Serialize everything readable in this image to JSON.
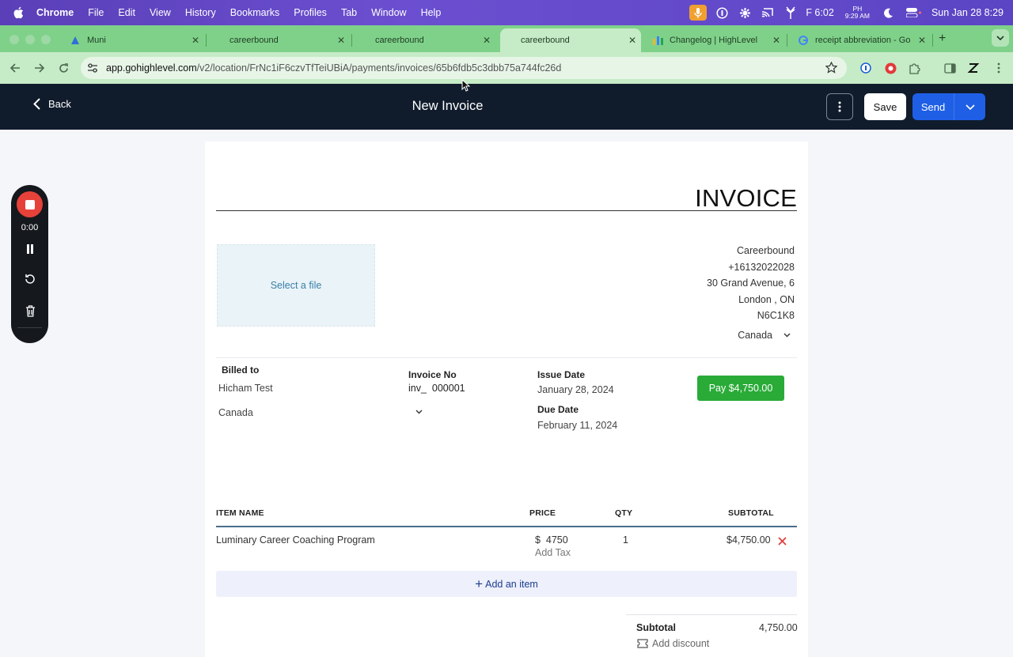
{
  "menubar": {
    "app": "Chrome",
    "items": [
      "File",
      "Edit",
      "View",
      "History",
      "Bookmarks",
      "Profiles",
      "Tab",
      "Window",
      "Help"
    ],
    "time_small": "F 6:02",
    "ph_top": "PH",
    "ph_bottom": "9:29 AM",
    "datetime": "Sun Jan 28  8:29"
  },
  "tabs": [
    {
      "title": "Muni"
    },
    {
      "title": "careerbound"
    },
    {
      "title": "careerbound"
    },
    {
      "title": "careerbound"
    },
    {
      "title": "Changelog | HighLevel"
    },
    {
      "title": "receipt abbreviation - Go"
    }
  ],
  "address": {
    "host": "app.gohighlevel.com",
    "path": "/v2/location/FrNc1iF6czvTfTeiUBiA/payments/invoices/65b6fdb5c3dbb75a744fc26d"
  },
  "header": {
    "back_label": "Back",
    "title": "New Invoice",
    "save_label": "Save",
    "send_label": "Send"
  },
  "recorder": {
    "time": "0:00"
  },
  "invoice": {
    "heading": "INVOICE",
    "file_prompt": "Select a file",
    "business": {
      "name": "Careerbound",
      "phone": "+16132022028",
      "address": "30 Grand Avenue, 6",
      "city": "London ,  ON",
      "postal": "N6C1K8",
      "country": "Canada"
    },
    "billed_to_label": "Billed to",
    "billed_to_name": "Hicham Test",
    "billed_to_country": "Canada",
    "invoice_no_label": "Invoice No",
    "invoice_prefix": "inv_",
    "invoice_no": "000001",
    "issue_date_label": "Issue Date",
    "issue_date": "January 28, 2024",
    "due_date_label": "Due Date",
    "due_date": "February 11, 2024",
    "pay_label": "Pay $4,750.00",
    "columns": {
      "item": "ITEM NAME",
      "price": "PRICE",
      "qty": "QTY",
      "subtotal": "SUBTOTAL"
    },
    "line_item": {
      "name": "Luminary Career Coaching Program",
      "currency": "$",
      "price": "4750",
      "add_tax": "Add Tax",
      "qty": "1",
      "subtotal": "$4,750.00"
    },
    "add_item_label": "Add an item",
    "subtotal_label": "Subtotal",
    "subtotal_value": "4,750.00",
    "add_discount_label": "Add discount"
  }
}
